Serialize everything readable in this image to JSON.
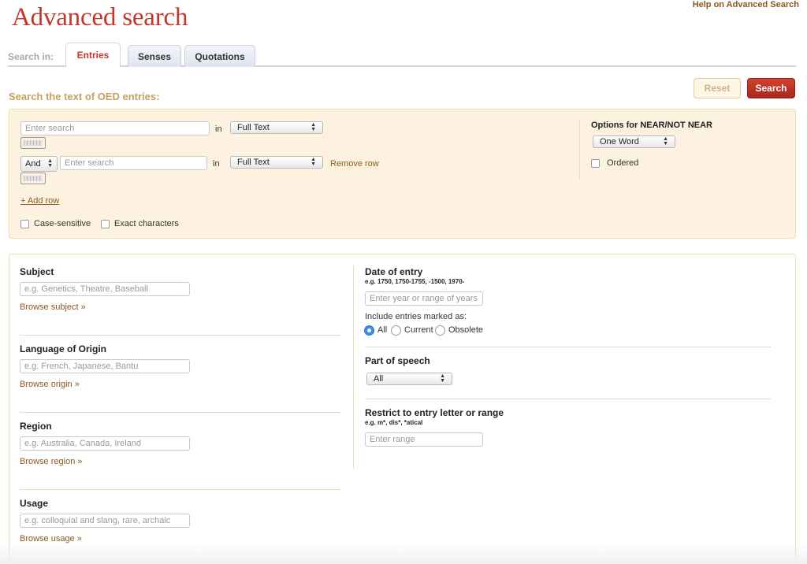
{
  "page": {
    "title": "Advanced search",
    "help_link": "Help on Advanced Search"
  },
  "tabs": {
    "search_in_label": "Search in:",
    "items": [
      {
        "label": "Entries",
        "active": true
      },
      {
        "label": "Senses",
        "active": false
      },
      {
        "label": "Quotations",
        "active": false
      }
    ]
  },
  "actions": {
    "reset_label": "Reset",
    "search_label": "Search"
  },
  "text_search": {
    "heading": "Search the text of OED entries:",
    "rows": [
      {
        "placeholder": "Enter search",
        "in_label": "in",
        "scope": "Full Text"
      },
      {
        "operator": "And",
        "placeholder": "Enter search",
        "in_label": "in",
        "scope": "Full Text",
        "remove_label": "Remove row"
      }
    ],
    "add_row_label": "+ Add row",
    "case_sensitive_label": "Case-sensitive",
    "exact_characters_label": "Exact characters",
    "near_options_title": "Options for NEAR/NOT NEAR",
    "near_distance": "One Word",
    "ordered_label": "Ordered"
  },
  "filters": {
    "subject": {
      "title": "Subject",
      "placeholder": "e.g. Genetics, Theatre, Baseball",
      "browse": "Browse subject »"
    },
    "origin": {
      "title": "Language of Origin",
      "placeholder": "e.g. French, Japanese, Bantu",
      "browse": "Browse origin »"
    },
    "region": {
      "title": "Region",
      "placeholder": "e.g. Australia, Canada, Ireland",
      "browse": "Browse region »"
    },
    "usage": {
      "title": "Usage",
      "placeholder": "e.g. colloquial and slang, rare, archaic",
      "browse": "Browse usage »"
    },
    "date": {
      "title": "Date of entry",
      "example": "e.g. 1750, 1750-1755, -1500, 1970-",
      "placeholder": "Enter year or range of years",
      "include_label": "Include entries marked as:",
      "options": [
        {
          "label": "All",
          "checked": true
        },
        {
          "label": "Current",
          "checked": false
        },
        {
          "label": "Obsolete",
          "checked": false
        }
      ]
    },
    "part_of_speech": {
      "title": "Part of speech",
      "value": "All"
    },
    "restrict": {
      "title": "Restrict to entry letter or range",
      "example": "e.g. m*, dis*, *atical",
      "placeholder": "Enter range"
    }
  },
  "colors": {
    "accent_red": "#c0392b",
    "link_brown": "#8a5a1c",
    "panel_cream": "#fdf2df",
    "radio_blue": "#3b8ee8"
  }
}
